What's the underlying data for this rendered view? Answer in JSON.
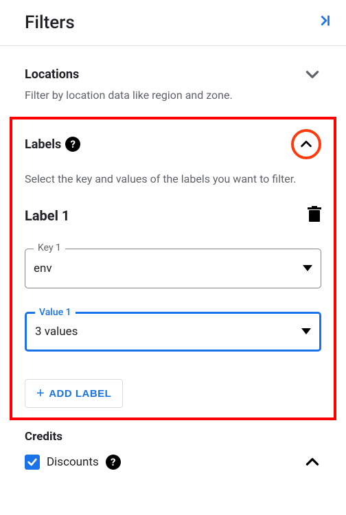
{
  "header": {
    "title": "Filters"
  },
  "locations": {
    "title": "Locations",
    "desc": "Filter by location data like region and zone."
  },
  "labels": {
    "title": "Labels",
    "desc": "Select the key and values of the labels you want to filter.",
    "block_title": "Label 1",
    "key_label": "Key 1",
    "key_value": "env",
    "value_label": "Value 1",
    "value_value": "3 values",
    "add_button": "ADD LABEL"
  },
  "credits": {
    "title": "Credits",
    "discount_label": "Discounts"
  }
}
